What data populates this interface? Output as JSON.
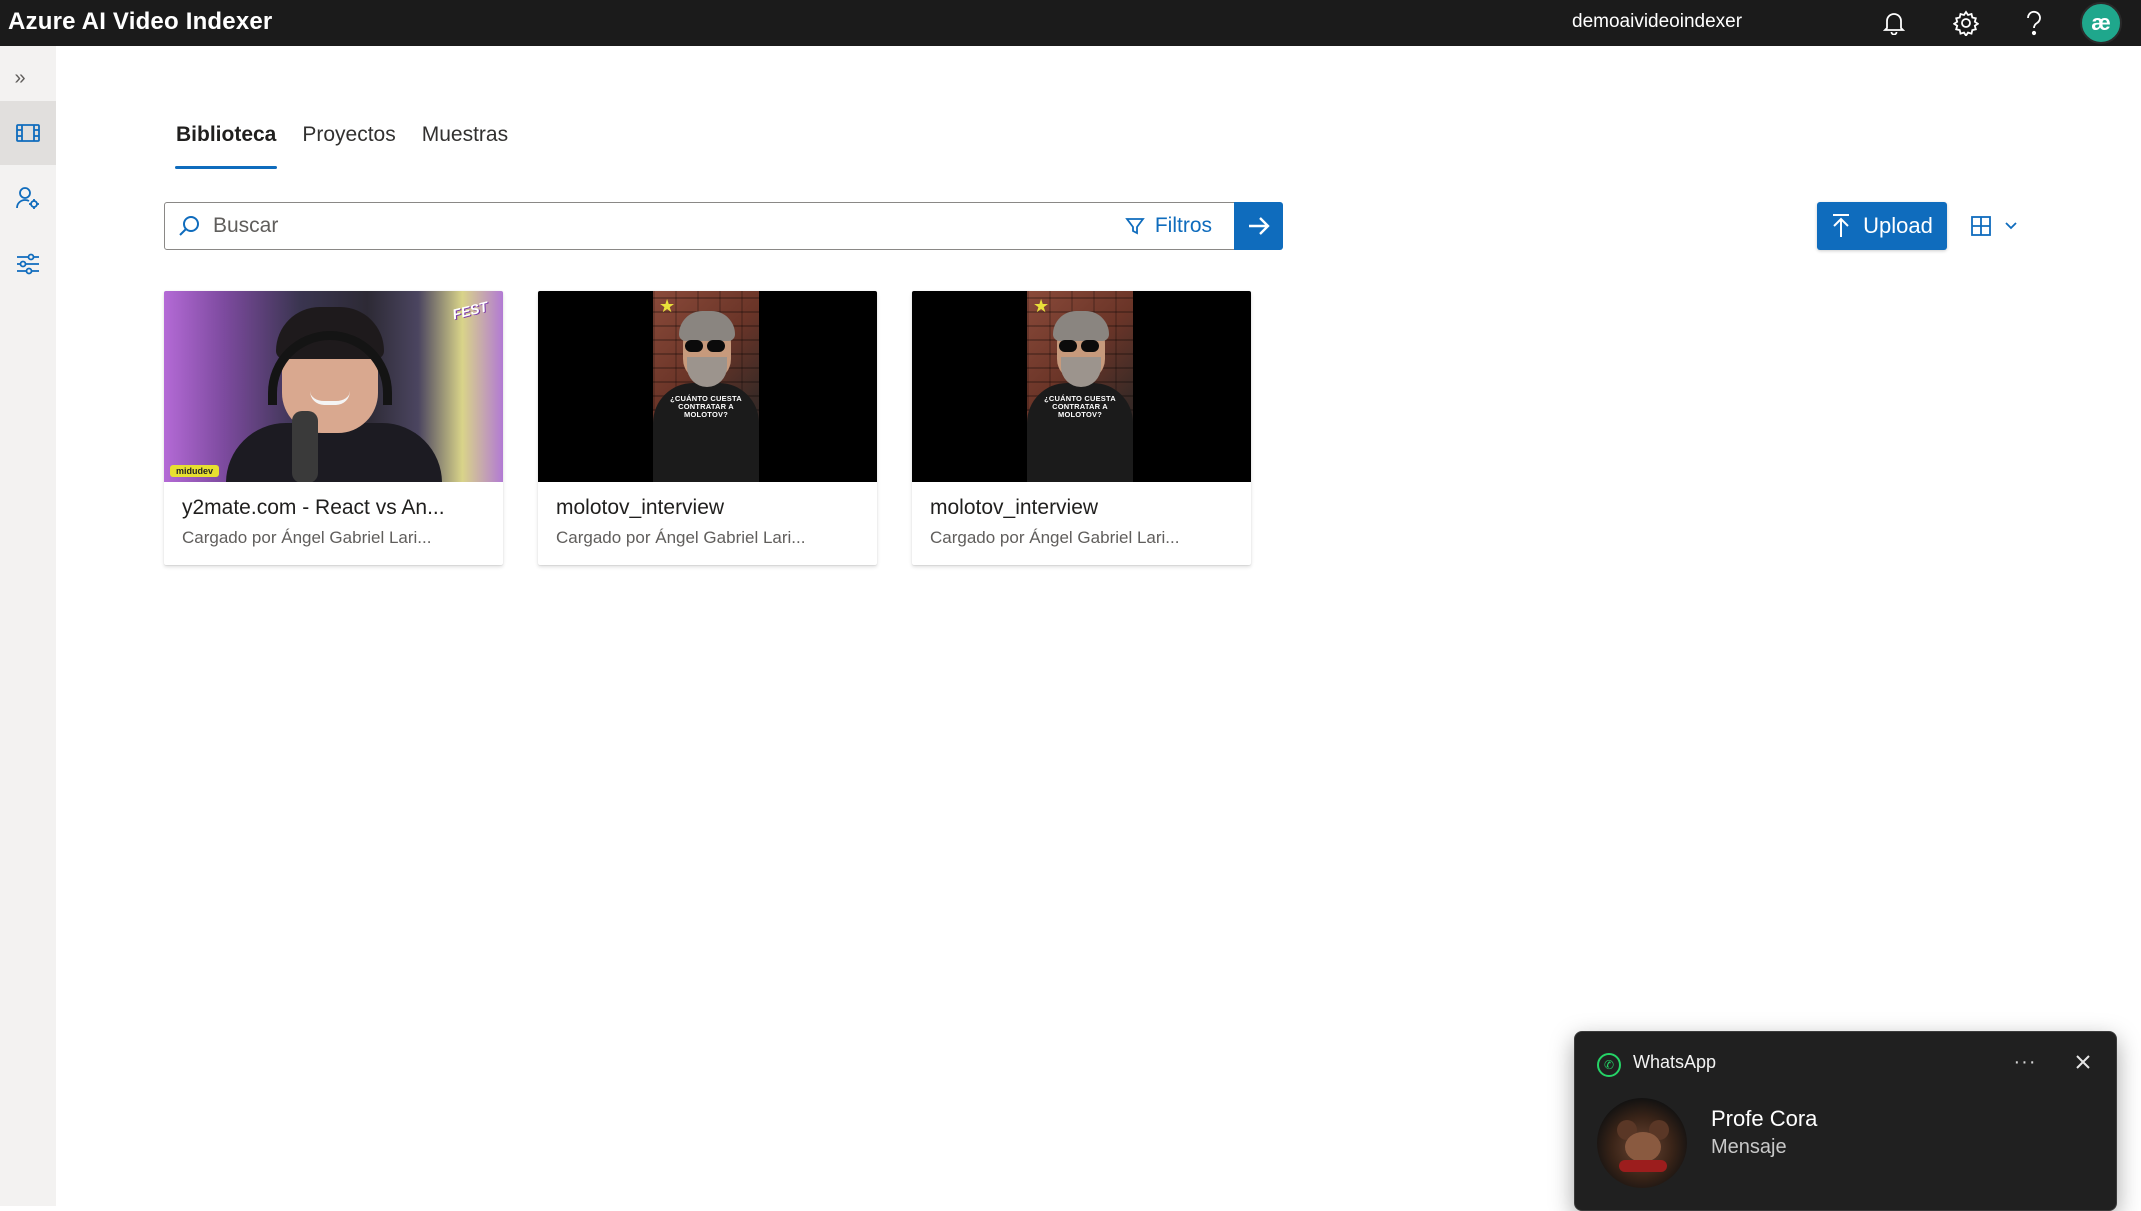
{
  "header": {
    "app_title": "Azure AI Video Indexer",
    "account_name": "demoaivideoindexer",
    "icons": [
      "bell-icon",
      "gear-icon",
      "help-icon"
    ],
    "avatar_initials": "æ"
  },
  "leftnav": {
    "expand_icon": "chevron-double-right-icon",
    "items": [
      {
        "icon": "film-icon",
        "active": true
      },
      {
        "icon": "person-settings-icon",
        "active": false
      },
      {
        "icon": "sliders-icon",
        "active": false
      }
    ]
  },
  "tabs": [
    {
      "label": "Biblioteca",
      "active": true
    },
    {
      "label": "Proyectos",
      "active": false
    },
    {
      "label": "Muestras",
      "active": false
    }
  ],
  "search": {
    "placeholder": "Buscar",
    "value": "",
    "filters_label": "Filtros"
  },
  "toolbar": {
    "upload_label": "Upload"
  },
  "videos": [
    {
      "title": "y2mate.com - React vs An...",
      "subtitle": "Cargado por Ángel Gabriel Lari...",
      "thumb_badge": "midudev",
      "thumb_logo": "FEST"
    },
    {
      "title": "molotov_interview",
      "subtitle": "Cargado por Ángel Gabriel Lari...",
      "thumb_caption": "¿CUÁNTO CUESTA CONTRATAR A MOLOTOV?"
    },
    {
      "title": "molotov_interview",
      "subtitle": "Cargado por Ángel Gabriel Lari...",
      "thumb_caption": "¿CUÁNTO CUESTA CONTRATAR A MOLOTOV?"
    }
  ],
  "notification": {
    "app_name": "WhatsApp",
    "more_label": "···",
    "sender": "Profe Cora",
    "message": "Mensaje"
  },
  "colors": {
    "accent": "#0f6cbd",
    "topbar": "#1b1b1b",
    "whatsapp_green": "#25d366"
  }
}
